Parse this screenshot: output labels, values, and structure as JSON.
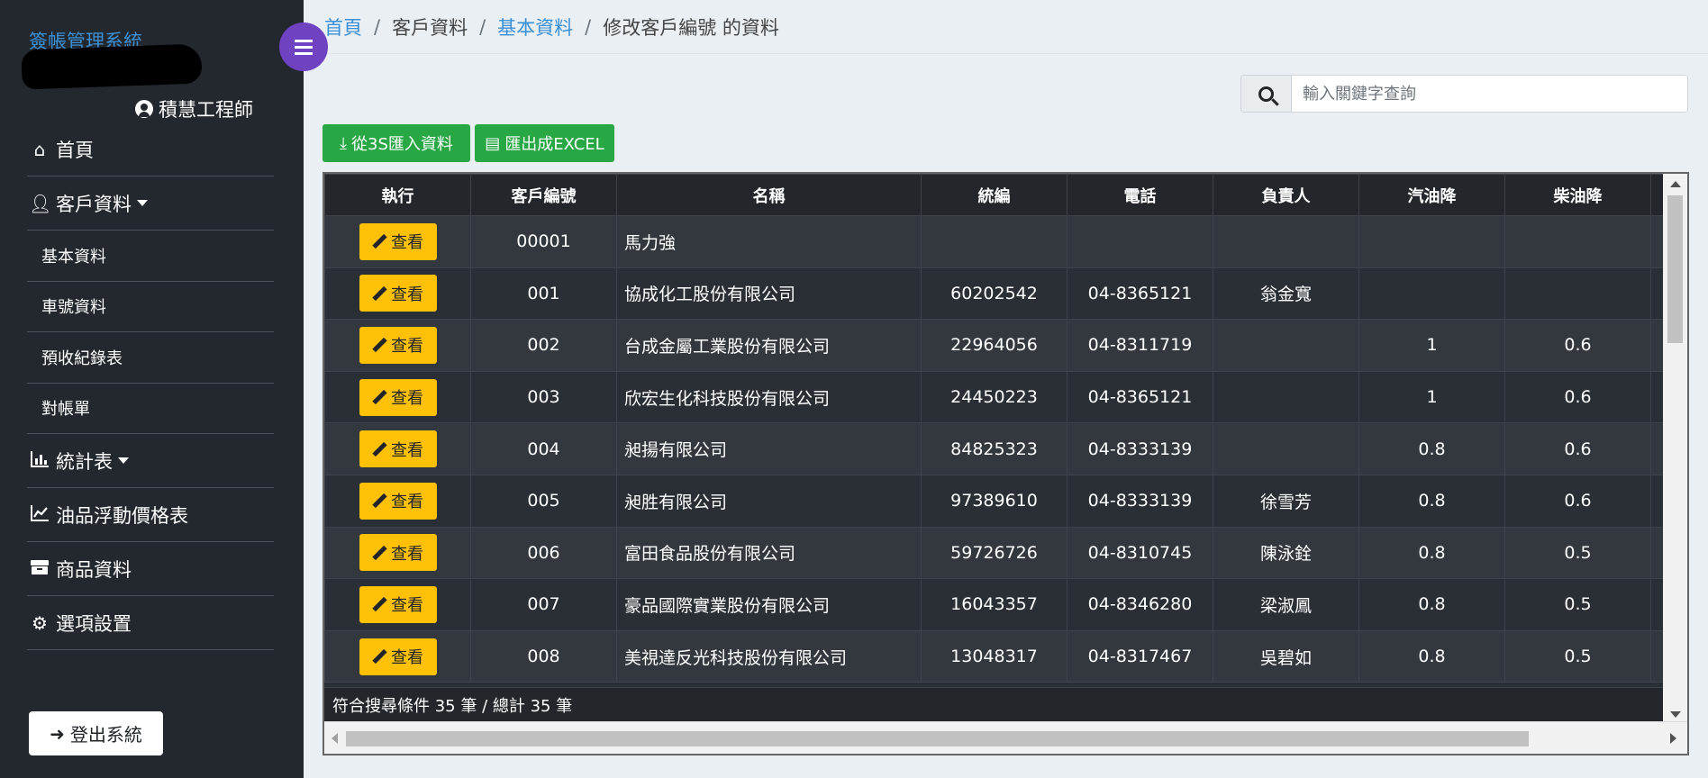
{
  "sidebar": {
    "brand": "簽帳管理系統",
    "user": "積慧工程師",
    "nav": [
      {
        "label": "首頁",
        "icon": "home-icon"
      },
      {
        "label": "客戶資料",
        "icon": "user-icon",
        "sub": [
          "基本資料",
          "車號資料",
          "預收紀錄表",
          "對帳單"
        ]
      },
      {
        "label": "統計表",
        "icon": "bar-chart-icon"
      },
      {
        "label": "油品浮動價格表",
        "icon": "line-chart-icon"
      },
      {
        "label": "商品資料",
        "icon": "box-icon"
      },
      {
        "label": "選項設置",
        "icon": "gear-icon"
      }
    ],
    "logout": "登出系統"
  },
  "breadcrumb": {
    "home": "首頁",
    "customer": "客戶資料",
    "basic": "基本資料",
    "current": "修改客戶編號 的資料",
    "sep": "/"
  },
  "search": {
    "placeholder": "輸入關鍵字查詢"
  },
  "toolbar": {
    "import_label": "從3S匯入資料",
    "export_label": "匯出成EXCEL"
  },
  "table": {
    "headers": [
      "執行",
      "客戶編號",
      "名稱",
      "統編",
      "電話",
      "負責人",
      "汽油降",
      "柴油降"
    ],
    "view_label": "查看",
    "rows": [
      {
        "id": "00001",
        "name": "馬力強",
        "tax": "",
        "phone": "",
        "owner": "",
        "gas": "",
        "diesel": ""
      },
      {
        "id": "001",
        "name": "協成化工股份有限公司",
        "tax": "60202542",
        "phone": "04-8365121",
        "owner": "翁金寬",
        "gas": "",
        "diesel": ""
      },
      {
        "id": "002",
        "name": "台成金屬工業股份有限公司",
        "tax": "22964056",
        "phone": "04-8311719",
        "owner": "",
        "gas": "1",
        "diesel": "0.6"
      },
      {
        "id": "003",
        "name": "欣宏生化科技股份有限公司",
        "tax": "24450223",
        "phone": "04-8365121",
        "owner": "",
        "gas": "1",
        "diesel": "0.6"
      },
      {
        "id": "004",
        "name": "昶揚有限公司",
        "tax": "84825323",
        "phone": "04-8333139",
        "owner": "",
        "gas": "0.8",
        "diesel": "0.6"
      },
      {
        "id": "005",
        "name": "昶胜有限公司",
        "tax": "97389610",
        "phone": "04-8333139",
        "owner": "徐雪芳",
        "gas": "0.8",
        "diesel": "0.6"
      },
      {
        "id": "006",
        "name": "富田食品股份有限公司",
        "tax": "59726726",
        "phone": "04-8310745",
        "owner": "陳泳銓",
        "gas": "0.8",
        "diesel": "0.5"
      },
      {
        "id": "007",
        "name": "豪品國際實業股份有限公司",
        "tax": "16043357",
        "phone": "04-8346280",
        "owner": "梁淑鳳",
        "gas": "0.8",
        "diesel": "0.5"
      },
      {
        "id": "008",
        "name": "美視達反光科技股份有限公司",
        "tax": "13048317",
        "phone": "04-8317467",
        "owner": "吳碧如",
        "gas": "0.8",
        "diesel": "0.5"
      }
    ],
    "footer": "符合搜尋條件 35 筆 / 總計 35 筆"
  }
}
